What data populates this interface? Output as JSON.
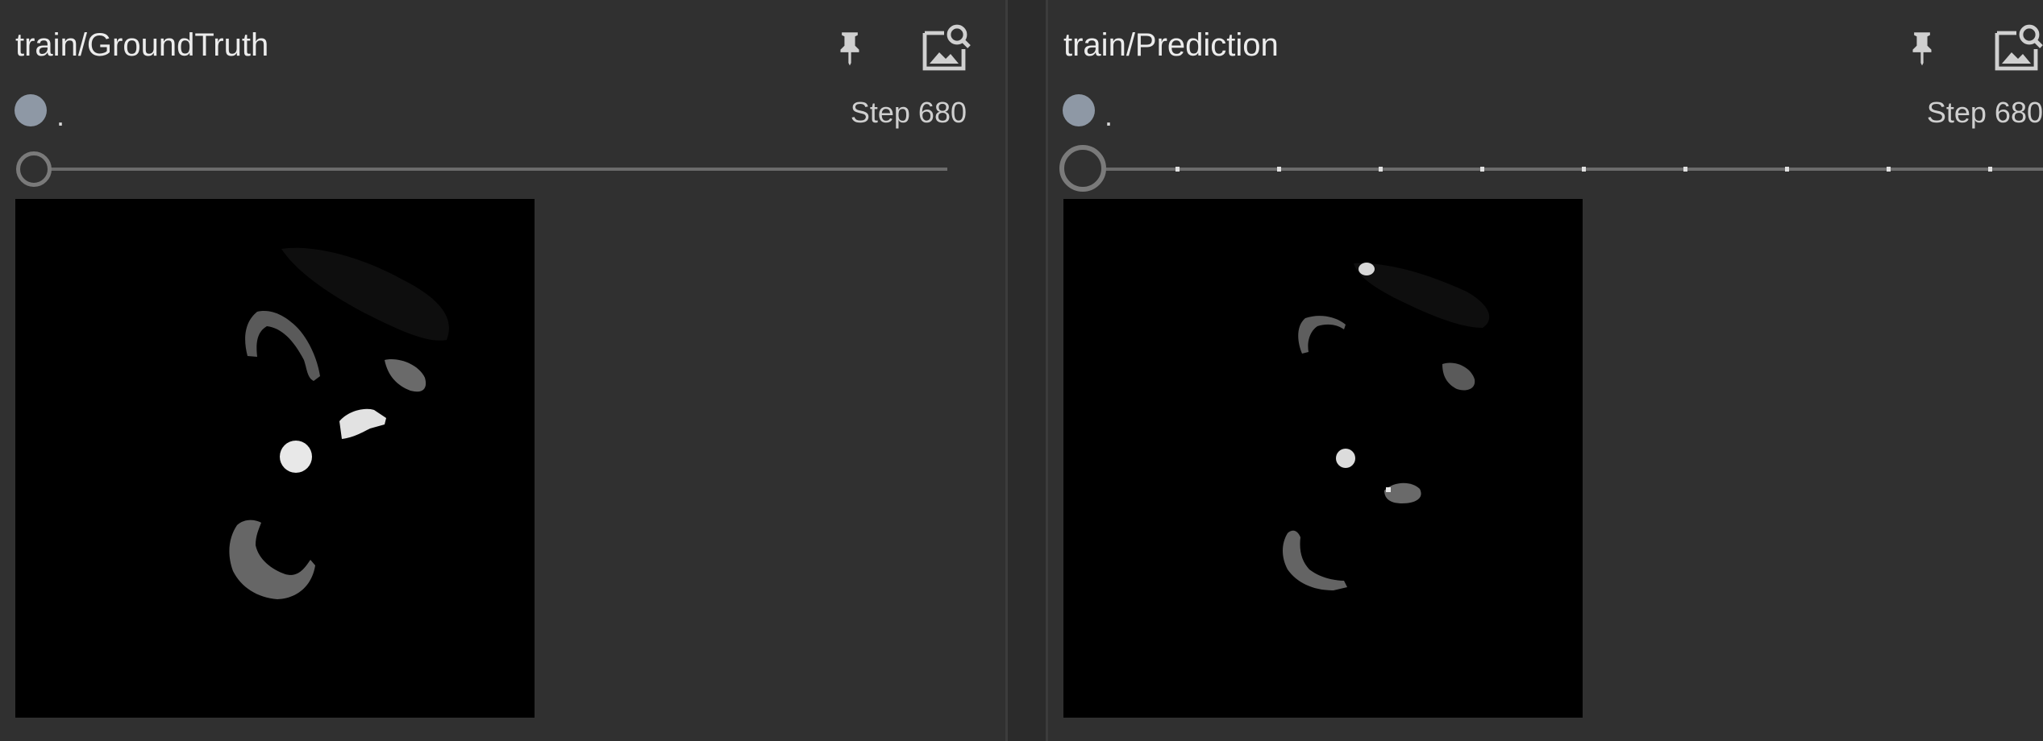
{
  "panels": [
    {
      "title": "train/GroundTruth",
      "run_name": ".",
      "step_label": "Step 680",
      "run_color": "#8e98a5",
      "icons": [
        "pin-icon",
        "image-zoom-icon"
      ]
    },
    {
      "title": "train/Prediction",
      "run_name": ".",
      "step_label": "Step 680",
      "run_color": "#8e98a5",
      "icons": [
        "pin-icon",
        "image-zoom-icon"
      ]
    }
  ],
  "colors": {
    "background": "#303030",
    "image_background": "#000000",
    "slider_track": "#6b6b6b",
    "slider_tick": "#e0e0e0"
  }
}
